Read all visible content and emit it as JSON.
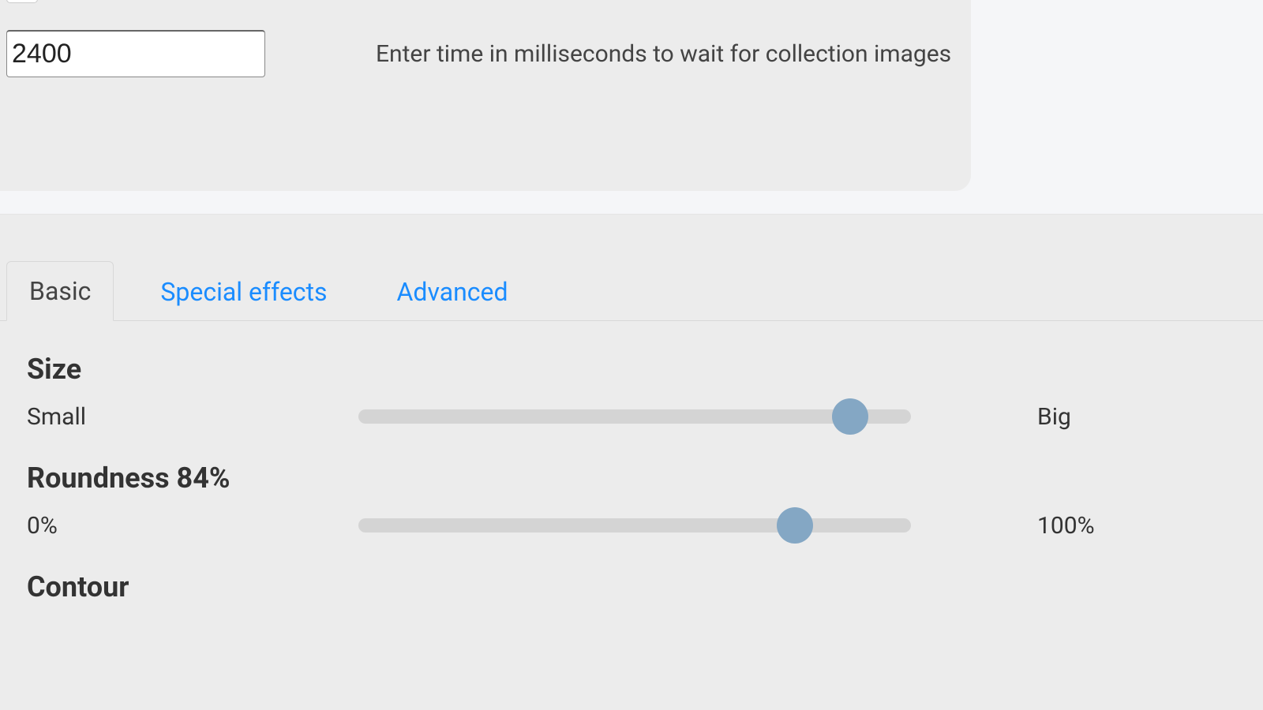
{
  "top": {
    "time_value": "2400",
    "time_desc": "Enter time in milliseconds to wait for collection images"
  },
  "tabs": {
    "basic": "Basic",
    "special": "Special effects",
    "advanced": "Advanced"
  },
  "size": {
    "title": "Size",
    "left": "Small",
    "right": "Big",
    "percent": 89
  },
  "roundness": {
    "title": "Roundness 84%",
    "left": "0%",
    "right": "100%",
    "percent": 79
  },
  "contour": {
    "title": "Contour"
  }
}
